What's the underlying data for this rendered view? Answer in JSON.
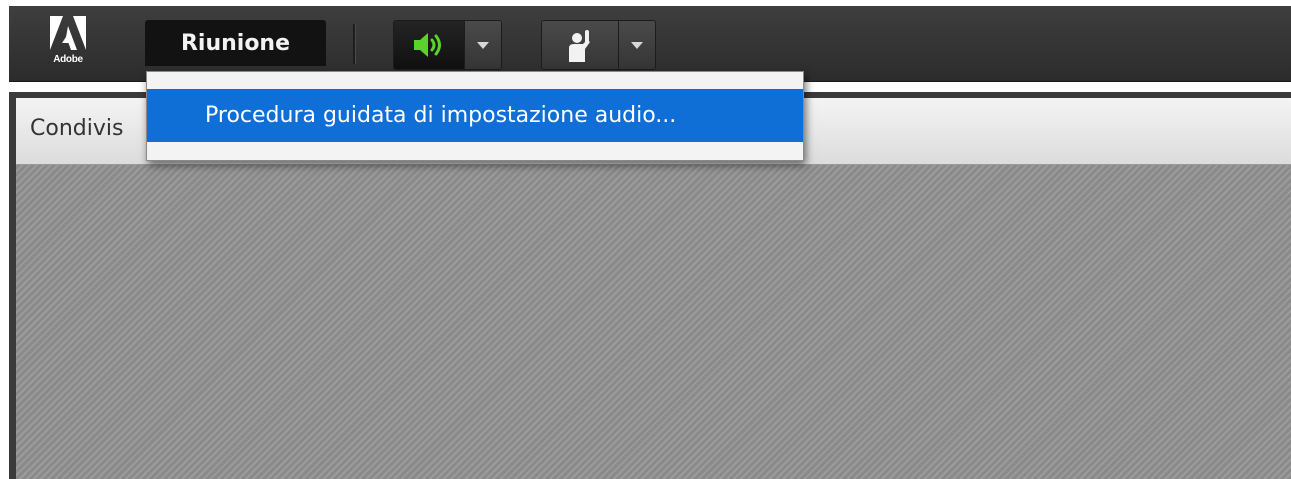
{
  "app": {
    "logo_text": "Adobe"
  },
  "menubar": {
    "meeting_menu_label": "Riunione"
  },
  "toolbar": {
    "audio_button_icon": "speaker-icon",
    "audio_icon_color": "#5ad32a",
    "status_button_icon": "raise-hand-icon"
  },
  "dropdown": {
    "items": [
      {
        "label": "Procedura guidata di impostazione audio..."
      }
    ],
    "highlight_color": "#0f6fd6"
  },
  "pod": {
    "title": "Condivis"
  }
}
